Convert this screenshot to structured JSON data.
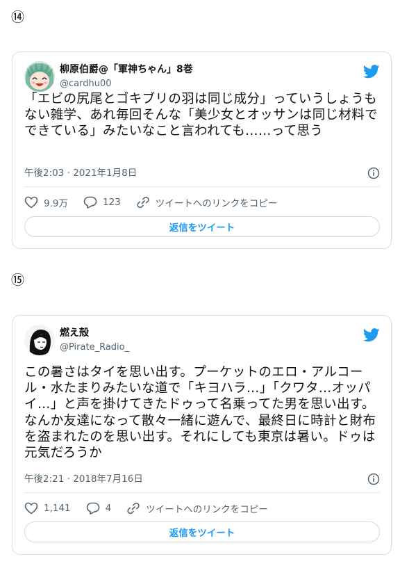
{
  "markers": [
    "⑭",
    "⑮"
  ],
  "tweets": [
    {
      "display_name": "柳原伯爵@「軍神ちゃん」8巻",
      "handle": "@cardhu00",
      "text": "「エビの尻尾とゴキブリの羽は同じ成分」っていうしょうもない雑学、あれ毎回そんな「美少女とオッサンは同じ材料でできている」みたいなこと言われても……って思う",
      "timestamp": "午後2:03 · 2021年1月8日",
      "likes": "9.9万",
      "replies": "123",
      "copy_link_label": "ツイートへのリンクをコピー",
      "reply_button_label": "返信をツイート"
    },
    {
      "display_name": "燃え殻",
      "handle": "@Pirate_Radio_",
      "text": "この暑さはタイを思い出す。プーケットのエロ・アルコール・水たまりみたいな道で「キヨハラ…」「クワタ…オッパイ…」と声を掛けてきたドゥって名乗ってた男を思い出す。なんか友達になって散々一緒に遊んで、最終日に時計と財布を盗まれたのを思い出す。それにしても東京は暑い。ドゥは元気だろうか",
      "timestamp": "午後2:21 · 2018年7月16日",
      "likes": "1,141",
      "replies": "4",
      "copy_link_label": "ツイートへのリンクをコピー",
      "reply_button_label": "返信をツイート"
    }
  ],
  "colors": {
    "accent": "#1d9bf0",
    "muted": "#536471",
    "border": "#d8dee3"
  }
}
